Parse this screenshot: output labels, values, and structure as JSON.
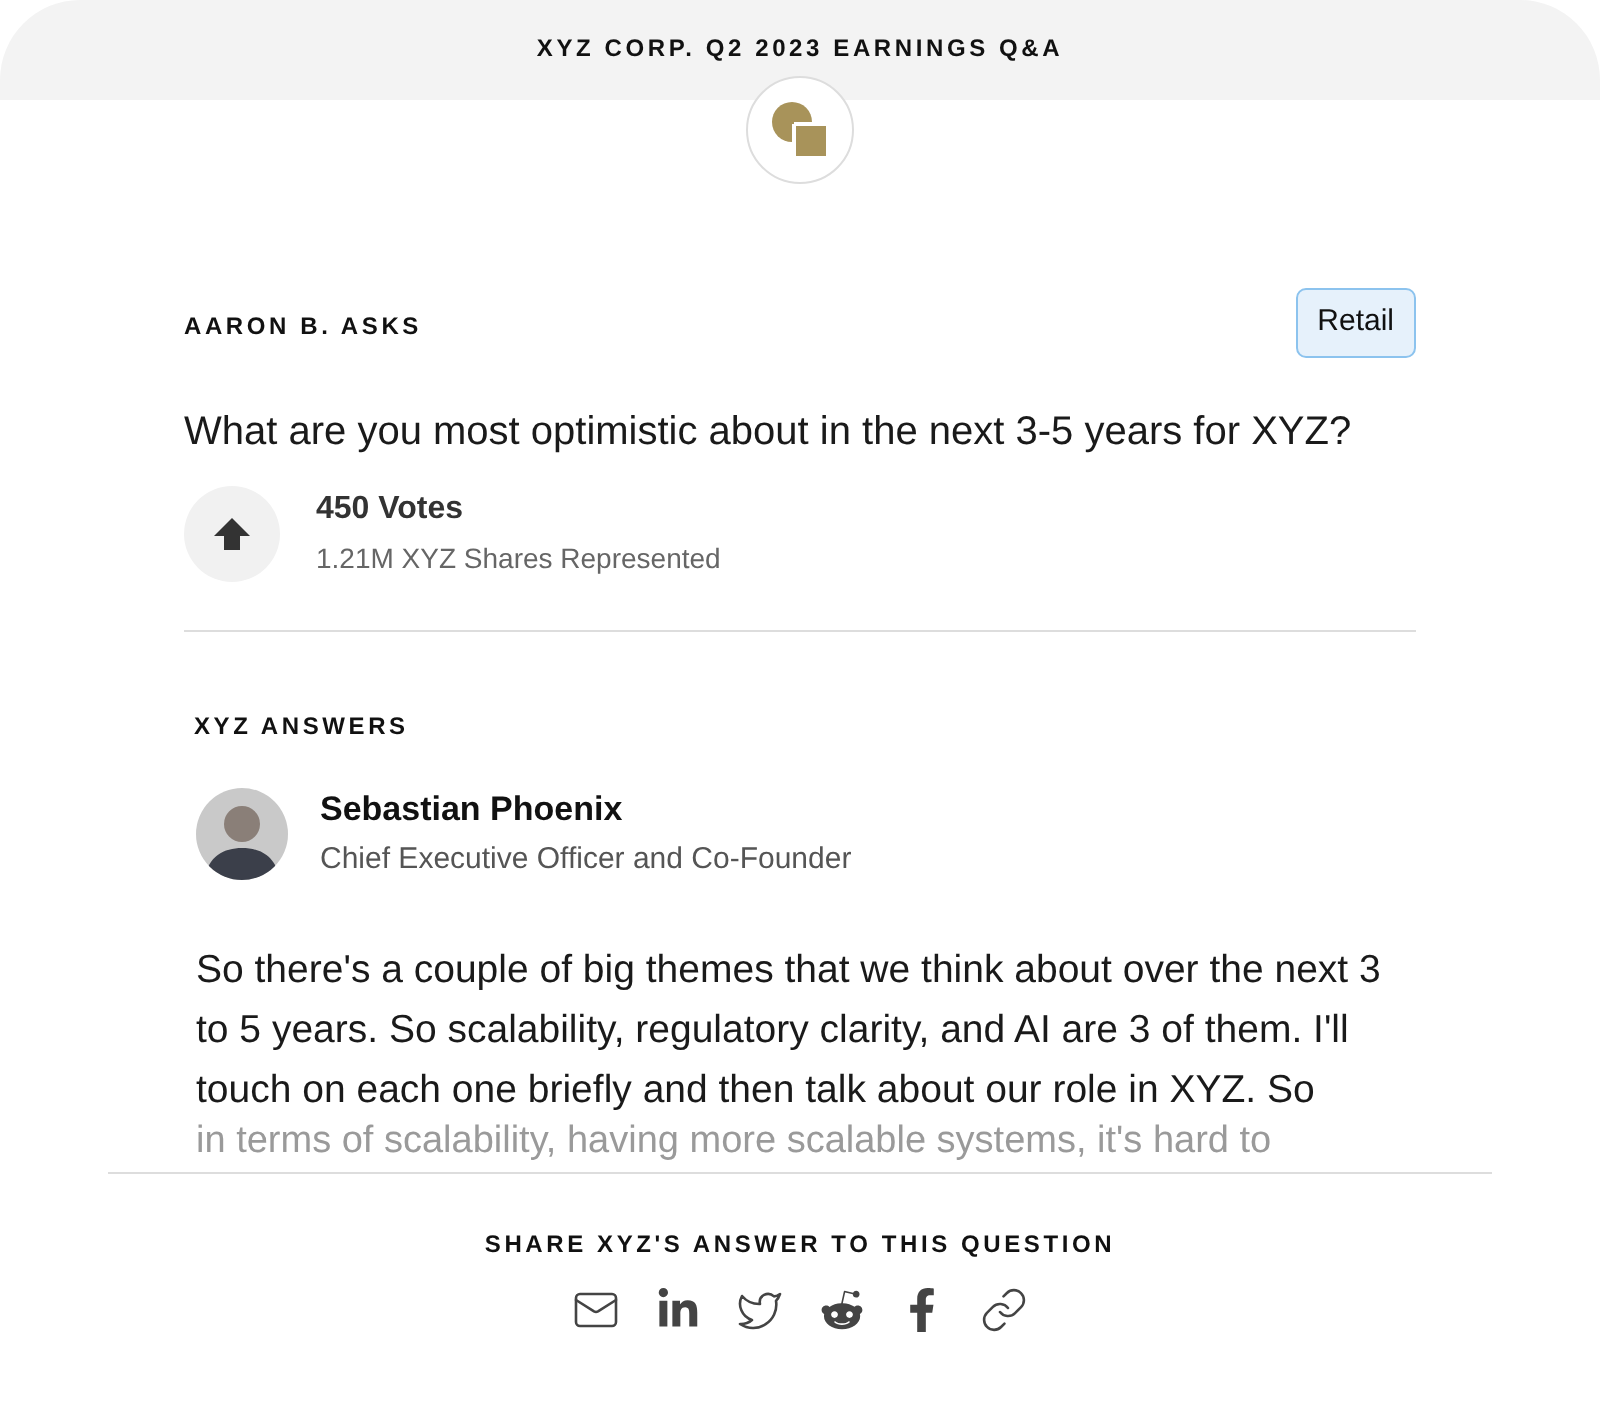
{
  "header": {
    "title": "XYZ CORP. Q2 2023 EARNINGS Q&A"
  },
  "question": {
    "asker": "AARON B. ASKS",
    "tag": "Retail",
    "text": "What are you most optimistic about in the next 3-5 years for XYZ?",
    "votes": "450 Votes",
    "shares": "1.21M XYZ Shares Represented"
  },
  "answer": {
    "label": "XYZ ANSWERS",
    "name": "Sebastian Phoenix",
    "role": "Chief Executive Officer and Co-Founder",
    "text": "So there's a couple of big themes that we think about over the next 3 to 5 years. So scalability, regulatory clarity, and AI are 3 of them. I'll touch on each one briefly and then talk about our role in XYZ. So",
    "faded_text": "in terms of scalability, having more scalable systems, it's hard to"
  },
  "share": {
    "title": "SHARE XYZ'S ANSWER TO THIS QUESTION",
    "buttons": [
      {
        "kind": "email"
      },
      {
        "kind": "linkedin"
      },
      {
        "kind": "twitter"
      },
      {
        "kind": "reddit"
      },
      {
        "kind": "facebook"
      },
      {
        "kind": "link"
      }
    ]
  }
}
